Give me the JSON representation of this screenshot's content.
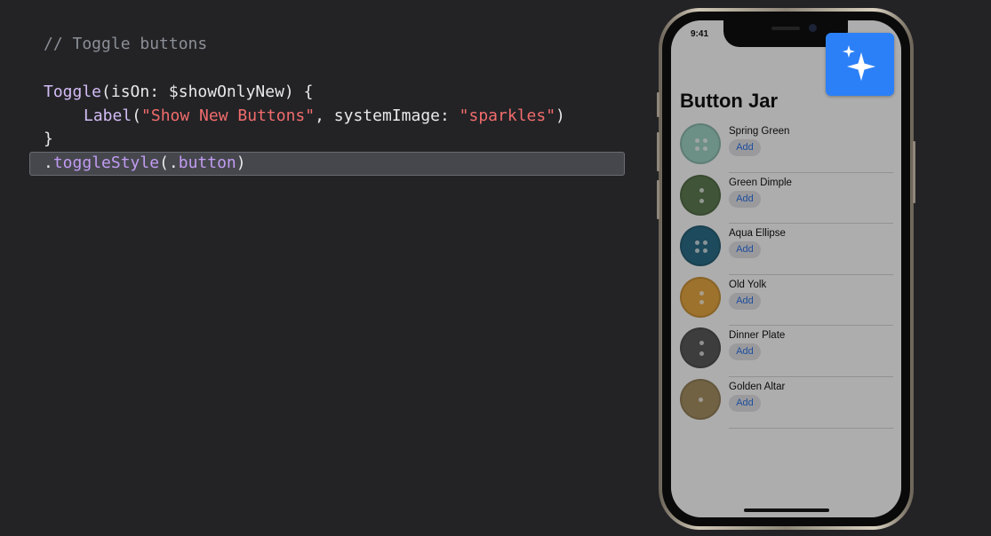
{
  "code": {
    "comment": "// Toggle buttons",
    "line1": {
      "type": "Toggle",
      "rest": "(isOn: $showOnlyNew) {"
    },
    "line2": {
      "type": "Label",
      "open": "(",
      "string1": "\"Show New Buttons\"",
      "middle": ", systemImage: ",
      "string2": "\"sparkles\"",
      "close": ")"
    },
    "line3": "}",
    "line4": {
      "dot": ".",
      "modifier": "toggleStyle",
      "open": "(",
      "dot2": ".",
      "arg": "button",
      "close": ")"
    }
  },
  "phone": {
    "status_time": "9:41",
    "app_title": "Button Jar",
    "items": [
      {
        "name": "Spring Green",
        "add_label": "Add",
        "color": "#9fd3c6"
      },
      {
        "name": "Green Dimple",
        "add_label": "Add",
        "color": "#5f7d53"
      },
      {
        "name": "Aqua Ellipse",
        "add_label": "Add",
        "color": "#2c6e88"
      },
      {
        "name": "Old Yolk",
        "add_label": "Add",
        "color": "#e8a842"
      },
      {
        "name": "Dinner Plate",
        "add_label": "Add",
        "color": "#5a5a5c"
      },
      {
        "name": "Golden Altar",
        "add_label": "Add",
        "color": "#a89165"
      }
    ],
    "toggle_icon": "sparkles-icon",
    "toggle_color": "#2c80f7"
  }
}
